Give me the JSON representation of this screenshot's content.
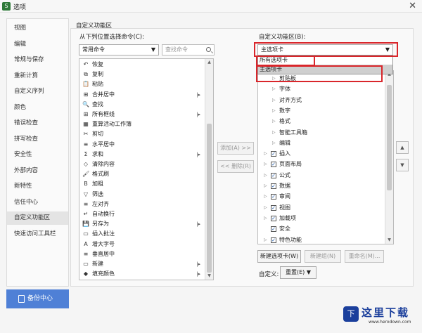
{
  "window": {
    "title": "选项",
    "app_icon_char": "S",
    "close_label": "✕"
  },
  "sidebar": {
    "items": [
      {
        "label": "视图"
      },
      {
        "label": "编辑"
      },
      {
        "label": "常规与保存"
      },
      {
        "label": "重新计算"
      },
      {
        "label": "自定义序列"
      },
      {
        "label": "颜色"
      },
      {
        "label": "错误检查"
      },
      {
        "label": "拼写检查"
      },
      {
        "label": "安全性"
      },
      {
        "label": "外部内容"
      },
      {
        "label": "新特性"
      },
      {
        "label": "信任中心"
      },
      {
        "label": "自定义功能区",
        "active": true
      },
      {
        "label": "快速访问工具栏"
      }
    ]
  },
  "backup_button": {
    "label": "备份中心"
  },
  "section": {
    "title": "自定义功能区"
  },
  "left": {
    "label": "从下列位置选择命令(C):",
    "source_select": "常用命令",
    "search_placeholder": "查找命令",
    "commands": [
      {
        "icon": "↶",
        "label": "恢复"
      },
      {
        "icon": "⧉",
        "label": "复制"
      },
      {
        "icon": "📋",
        "label": "粘贴"
      },
      {
        "icon": "⊞",
        "label": "合并居中",
        "sub": "|▸"
      },
      {
        "icon": "🔍",
        "label": "查找"
      },
      {
        "icon": "⊞",
        "label": "所有框线",
        "sub": "|▸"
      },
      {
        "icon": "▦",
        "label": "重算活动工作簿"
      },
      {
        "icon": "✂",
        "label": "剪切"
      },
      {
        "icon": "≡",
        "label": "水平居中"
      },
      {
        "icon": "Σ",
        "label": "求和",
        "sub": "|▸"
      },
      {
        "icon": "◇",
        "label": "清除内容"
      },
      {
        "icon": "🖌",
        "label": "格式刷"
      },
      {
        "icon": "B",
        "label": "加粗"
      },
      {
        "icon": "▽",
        "label": "筛选"
      },
      {
        "icon": "≡",
        "label": "左对齐"
      },
      {
        "icon": "↵",
        "label": "自动换行"
      },
      {
        "icon": "💾",
        "label": "另存为",
        "sub": "|▸"
      },
      {
        "icon": "▭",
        "label": "插入批注"
      },
      {
        "icon": "A",
        "label": "增大字号"
      },
      {
        "icon": "≡",
        "label": "垂直居中"
      },
      {
        "icon": "▭",
        "label": "新建",
        "sub": "|▸"
      },
      {
        "icon": "◆",
        "label": "填充颜色",
        "sub": "|▸"
      }
    ]
  },
  "middle": {
    "add_label": "添加(A) >>",
    "remove_label": "<< 删除(R)"
  },
  "right": {
    "label": "自定义功能区(B):",
    "tabs_select": "主选项卡",
    "dropdown_options": [
      {
        "label": "所有选项卡"
      },
      {
        "label": "主选项卡",
        "selected": true
      }
    ],
    "tree": [
      {
        "label": "剪贴板",
        "level": 2,
        "arrow": "▷",
        "checkbox": false
      },
      {
        "label": "字体",
        "level": 2,
        "arrow": "▷",
        "checkbox": false
      },
      {
        "label": "对齐方式",
        "level": 2,
        "arrow": "▷",
        "checkbox": false
      },
      {
        "label": "数字",
        "level": 2,
        "arrow": "▷",
        "checkbox": false
      },
      {
        "label": "格式",
        "level": 2,
        "arrow": "▷",
        "checkbox": false
      },
      {
        "label": "智能工具箱",
        "level": 2,
        "arrow": "▷",
        "checkbox": false
      },
      {
        "label": "编辑",
        "level": 2,
        "arrow": "▷",
        "checkbox": false
      },
      {
        "label": "插入",
        "level": 1,
        "arrow": "▷",
        "checkbox": true
      },
      {
        "label": "页面布局",
        "level": 1,
        "arrow": "▷",
        "checkbox": true
      },
      {
        "label": "公式",
        "level": 1,
        "arrow": "▷",
        "checkbox": true
      },
      {
        "label": "数据",
        "level": 1,
        "arrow": "▷",
        "checkbox": true
      },
      {
        "label": "审阅",
        "level": 1,
        "arrow": "▷",
        "checkbox": true
      },
      {
        "label": "视图",
        "level": 1,
        "arrow": "▷",
        "checkbox": true
      },
      {
        "label": "加载项",
        "level": 1,
        "arrow": "▷",
        "checkbox": true
      },
      {
        "label": "安全",
        "level": 1,
        "arrow": "",
        "checkbox": true
      },
      {
        "label": "特色功能",
        "level": 1,
        "arrow": "▷",
        "checkbox": true
      }
    ],
    "new_tab_label": "新建选项卡(W)",
    "new_group_label": "新建组(N)",
    "rename_label": "重命名(M)...",
    "customize_label": "自定义:",
    "reset_label": "重置(E)",
    "move_up": "▲",
    "move_down": "▼"
  },
  "watermark": {
    "mark": "下",
    "title": "这里下载",
    "url": "www.herodown.com"
  }
}
